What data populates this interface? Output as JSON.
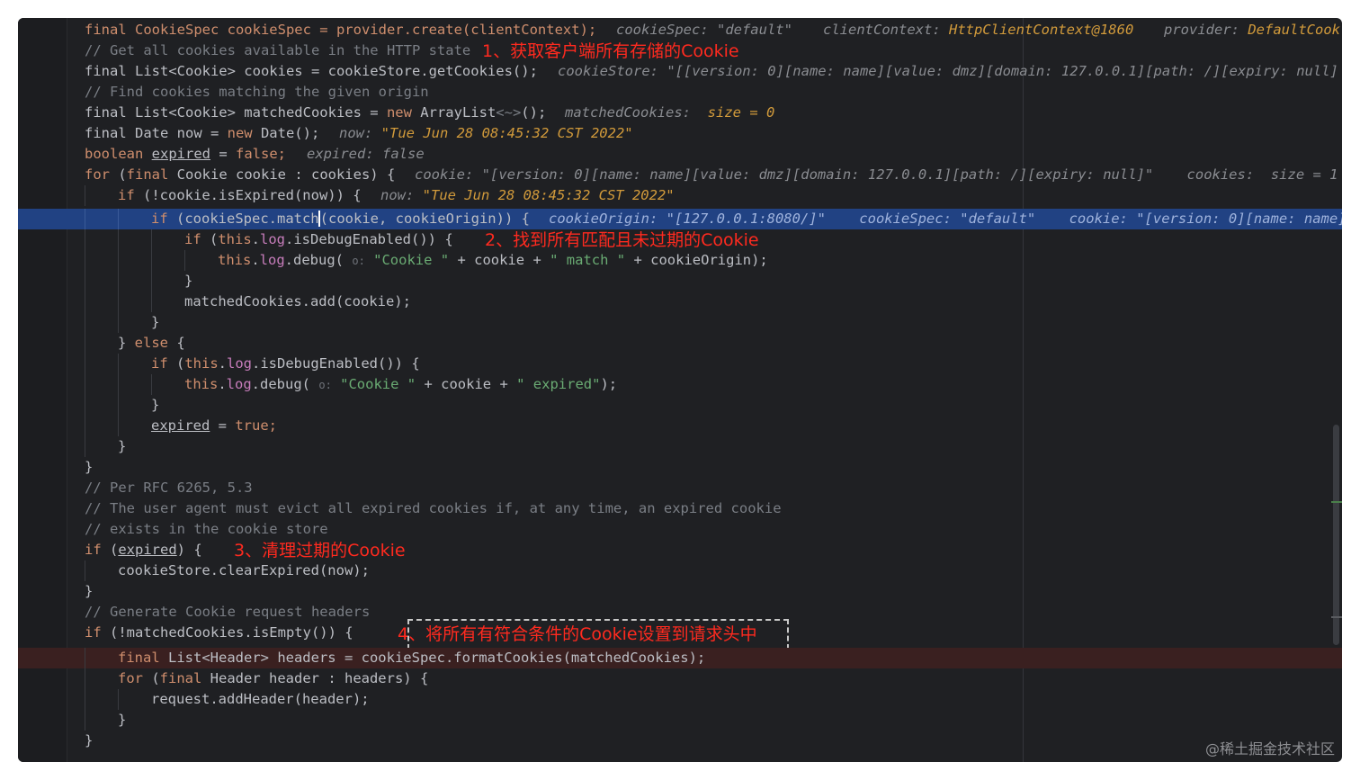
{
  "editor": {
    "watermark": "@稀土掘金技术社区"
  },
  "annotations": {
    "a1": "1、获取客户端所有存储的Cookie",
    "a2": "2、找到所有匹配且未过期的Cookie",
    "a3": "3、清理过期的Cookie",
    "a4": "4、将所有有符合条件的Cookie设置到请求头中"
  },
  "code": {
    "l1_decl": "final CookieSpec cookieSpec = provider.create(clientContext);",
    "l1_i1_key": "cookieSpec: ",
    "l1_i1_val": "\"default\"",
    "l1_i2_key": "clientContext: ",
    "l1_i2_val": "HttpClientContext@1860",
    "l1_i3_key": "provider: ",
    "l1_i3_val": "DefaultCook",
    "l2_comment": "// Get all cookies available in the HTTP state",
    "l3_decl": "final List<Cookie> cookies = cookieStore.getCookies();",
    "l3_inlay": "cookieStore: \"[[version: 0][name: name][value: dmz][domain: 127.0.0.1][path: /][expiry: null]",
    "l4_comment": "// Find cookies matching the given origin",
    "l5_a": "final List<Cookie> matchedCookies = ",
    "l5_new": "new",
    "l5_b": " ArrayList",
    "l5_diamond": "<~>",
    "l5_c": "();",
    "l5_i_key": "matchedCookies: ",
    "l5_i_val": "size = 0",
    "l6_a": "final Date now = ",
    "l6_new": "new",
    "l6_b": " Date();",
    "l6_i_key": "now: ",
    "l6_i_val": "\"Tue Jun 28 08:45:32 CST 2022\"",
    "l7_kw": "boolean",
    "l7_var": "expired",
    "l7_eq": " = ",
    "l7_false": "false",
    "l7_semi": ";",
    "l7_inlay": "expired: false",
    "l8_for": "for",
    "l8_a": " (",
    "l8_final": "final",
    "l8_b": " Cookie cookie : cookies) {",
    "l8_inlay": "cookie: \"[version: 0][name: name][value: dmz][domain: 127.0.0.1][path: /][expiry: null]\"    cookies:  size = 1",
    "l9_if": "if",
    "l9_a": " (!cookie.isExpired(now)) {",
    "l9_i_key": "now: ",
    "l9_i_val": "\"Tue Jun 28 08:45:32 CST 2022\"",
    "l10_if": "if",
    "l10_a": " (cookieSpec.match",
    "l10_b": "(cookie, cookieOrigin)) {",
    "l10_inlay": "cookieOrigin: \"[127.0.0.1:8080/]\"    cookieSpec: \"default\"    cookie: \"[version: 0][name: name]",
    "l11_if": "if",
    "l11_this": "this",
    "l11_log": "log",
    "l11_a": ".isDebugEnabled()) {",
    "l12_this": "this",
    "l12_log": "log",
    "l12_a": ".debug(",
    "l12_hint": "o:",
    "l12_s1": "\"Cookie \"",
    "l12_b": " + cookie + ",
    "l12_s2": "\" match \"",
    "l12_c": " + cookieOrigin);",
    "l13": "}",
    "l14": "matchedCookies.add(cookie);",
    "l15": "}",
    "l16_a": "} ",
    "l16_else": "else",
    "l16_b": " {",
    "l17_if": "if",
    "l17_this": "this",
    "l17_log": "log",
    "l17_a": ".isDebugEnabled()) {",
    "l18_this": "this",
    "l18_log": "log",
    "l18_a": ".debug(",
    "l18_hint": "o:",
    "l18_s1": "\"Cookie \"",
    "l18_b": " + cookie + ",
    "l18_s2": "\" expired\"",
    "l18_c": ");",
    "l19": "}",
    "l20_var": "expired",
    "l20_eq": " = ",
    "l20_true": "true",
    "l20_semi": ";",
    "l21": "}",
    "l22": "}",
    "l23_comment": "// Per RFC 6265, 5.3",
    "l24_comment": "// The user agent must evict all expired cookies if, at any time, an expired cookie",
    "l25_comment": "// exists in the cookie store",
    "l26_if": "if",
    "l26_a": " (",
    "l26_var": "expired",
    "l26_b": ") {",
    "l27": "cookieStore.clearExpired(now);",
    "l28": "}",
    "l29_comment": "// Generate Cookie request headers",
    "l30_if": "if",
    "l30_a": " (!matchedCookies.isEmpty()) {",
    "l31_final": "final",
    "l31_a": " List<Header> headers = cookieSpec.formatCookies(matchedCookies);",
    "l32_for": "for",
    "l32_a": " (",
    "l32_final": "final",
    "l32_b": " Header header : headers) {",
    "l33": "request.addHeader(header);",
    "l34": "}",
    "l35": "}"
  }
}
